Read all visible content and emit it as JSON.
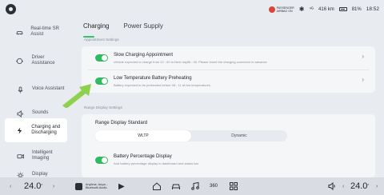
{
  "status": {
    "airbag_line1": "PASSENGER",
    "airbag_line2": "AIRBAG ON",
    "signal": "⁴ᴳ",
    "range": "416 km",
    "battery": "81%",
    "time": "18:52"
  },
  "sidebar": {
    "items": [
      {
        "label": "Real-time SR Assist",
        "icon": "car-sr-icon"
      },
      {
        "label": "Driver Assistance",
        "icon": "steering-assist-icon"
      },
      {
        "label": "Voice Assistant",
        "icon": "voice-icon"
      },
      {
        "label": "Sounds",
        "icon": "speaker-icon"
      },
      {
        "label": "Charging and Discharging",
        "icon": "charging-icon"
      },
      {
        "label": "Intelligent Imaging",
        "icon": "camera-icon"
      },
      {
        "label": "Display",
        "icon": "brightness-icon"
      }
    ],
    "active_index": 4
  },
  "tabs": [
    "Charging",
    "Power Supply"
  ],
  "active_tab": 0,
  "sections": {
    "appointment": "Appointment Settings",
    "range_display": "Range Display Settings"
  },
  "rows": {
    "slow_charging": {
      "title": "Slow Charging Appointment",
      "desc": "Vehicle expected to charge from 22 : 00 to Next day06 : 00. Please insert the charging connector in advance",
      "enabled": true
    },
    "low_temp": {
      "title": "Low Temperature Battery Preheating",
      "desc": "Battery expected to be preheated before 08 : 11 at low temperatures",
      "enabled": true
    },
    "range_standard": {
      "title": "Range Display Standard",
      "options": [
        "WLTP",
        "Dynamic"
      ],
      "selected": 0
    },
    "battery_percentage": {
      "title": "Battery Percentage Display",
      "desc": "Add battery percentage display to dashboard and status bar",
      "enabled": true
    }
  },
  "dock": {
    "left_temp": "24.0",
    "right_temp": "24.0",
    "deg": "°",
    "media_line1": "Anytime, Anyw...",
    "media_line2": "Bluetooth Audio",
    "app_360": "360"
  },
  "colors": {
    "accent_green": "#2fbb62",
    "arrow_green": "#8fd14f",
    "airbag_red": "#d8453b"
  }
}
